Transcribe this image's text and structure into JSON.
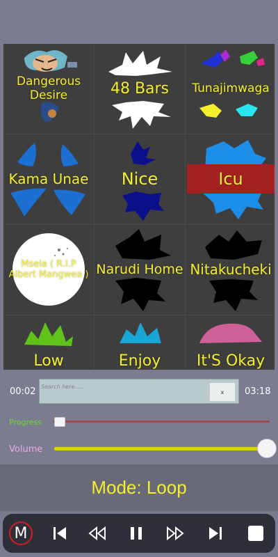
{
  "tiles": [
    {
      "label": "Dangerous Desire",
      "line1": "Dangerous",
      "line2": "Desire",
      "icon": "cartoon-face-icon"
    },
    {
      "label": "48 Bars",
      "icon": "white-splash-icon"
    },
    {
      "label": "Tunajimwaga",
      "icon": "multicolor-splash-icon"
    },
    {
      "label": "Kama Unae",
      "icon": "blue-splash-icon"
    },
    {
      "label": "Nice",
      "icon": "navy-splash-icon"
    },
    {
      "label": "Icu",
      "icon": "lightblue-splash-icon",
      "selected": true
    },
    {
      "label": "Msela ( R.I.P Albert Mangwea )",
      "line1": "Msela ( R.I.P",
      "line2": "Albert Mangwea )",
      "icon": "white-circle-icon"
    },
    {
      "label": "Narudi Home",
      "icon": "black-splash-icon"
    },
    {
      "label": "Nitakucheki",
      "icon": "black-splash-icon"
    },
    {
      "label": "Low",
      "icon": "green-splash-icon"
    },
    {
      "label": "Enjoy",
      "icon": "cyan-splash-icon"
    },
    {
      "label": "It'S Okay",
      "icon": "pink-splash-icon"
    }
  ],
  "player": {
    "elapsed": "00:02",
    "duration": "03:18",
    "search_placeholder": "Search here.....",
    "clear_label": "x",
    "progress_label": "Progress",
    "volume_label": "Volume",
    "progress_fraction": 0.02,
    "volume_fraction": 1.0
  },
  "mode": {
    "text": "Mode: Loop"
  },
  "buttons": [
    {
      "name": "mode-button",
      "label": "M"
    },
    {
      "name": "previous-button",
      "icon": "skip-previous-icon"
    },
    {
      "name": "rewind-button",
      "icon": "rewind-icon"
    },
    {
      "name": "pause-button",
      "icon": "pause-icon"
    },
    {
      "name": "fast-forward-button",
      "icon": "fast-forward-icon"
    },
    {
      "name": "next-button",
      "icon": "skip-next-icon"
    },
    {
      "name": "stop-button",
      "icon": "stop-icon"
    }
  ],
  "colors": {
    "label": "#f5ee2f",
    "selected_bar": "#a32121",
    "progress_label": "#6ad83a",
    "volume_label": "#e7a9f0",
    "volume_track": "#d8d400",
    "progress_track": "#9a4a4a",
    "background": "#7b7c8f"
  }
}
